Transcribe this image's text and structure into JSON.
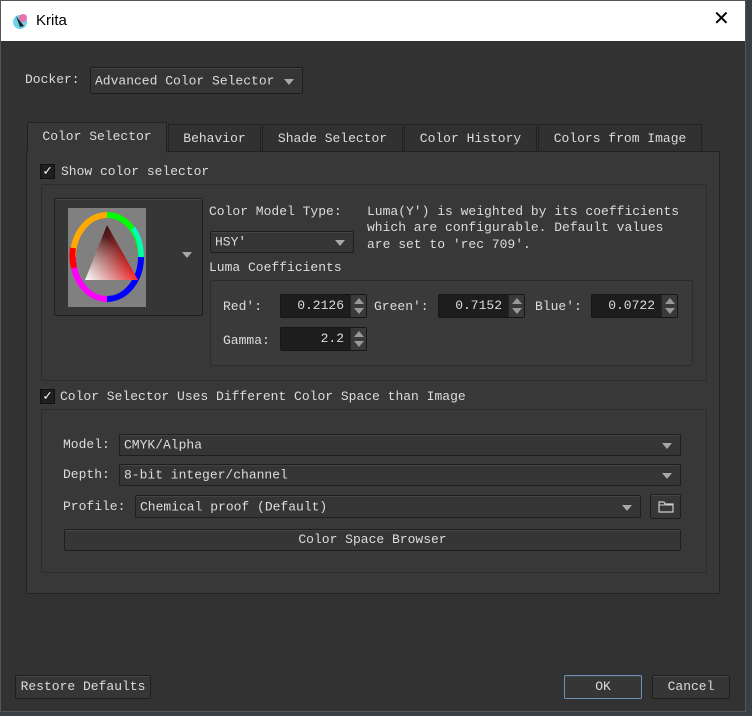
{
  "window": {
    "title": "Krita",
    "close_icon": "close-icon"
  },
  "docker": {
    "label": "Docker:",
    "value": "Advanced Color Selector"
  },
  "tabs": [
    {
      "label": "Color Selector"
    },
    {
      "label": "Behavior"
    },
    {
      "label": "Shade Selector"
    },
    {
      "label": "Color History"
    },
    {
      "label": "Colors from Image"
    }
  ],
  "color_selector": {
    "show_label": "Show color selector",
    "show_checked": true,
    "model_type_label": "Color Model Type:",
    "model_type_value": "HSY'",
    "description": [
      "Luma(Y') is weighted by its coefficients",
      "which are configurable. Default values",
      "are set to 'rec 709'."
    ],
    "luma_label": "Luma Coefficients",
    "red_label": "Red':",
    "red_value": "0.2126",
    "green_label": "Green':",
    "green_value": "0.7152",
    "blue_label": "Blue':",
    "blue_value": "0.0722",
    "gamma_label": "Gamma:",
    "gamma_value": "2.2"
  },
  "color_space": {
    "checkbox_label": "Color Selector Uses Different Color Space than Image",
    "checked": true,
    "model_label": "Model:",
    "model_value": "CMYK/Alpha",
    "depth_label": "Depth:",
    "depth_value": "8-bit integer/channel",
    "profile_label": "Profile:",
    "profile_value": "Chemical proof (Default)",
    "browser_button": "Color Space Browser"
  },
  "footer": {
    "restore": "Restore Defaults",
    "ok": "OK",
    "cancel": "Cancel"
  }
}
